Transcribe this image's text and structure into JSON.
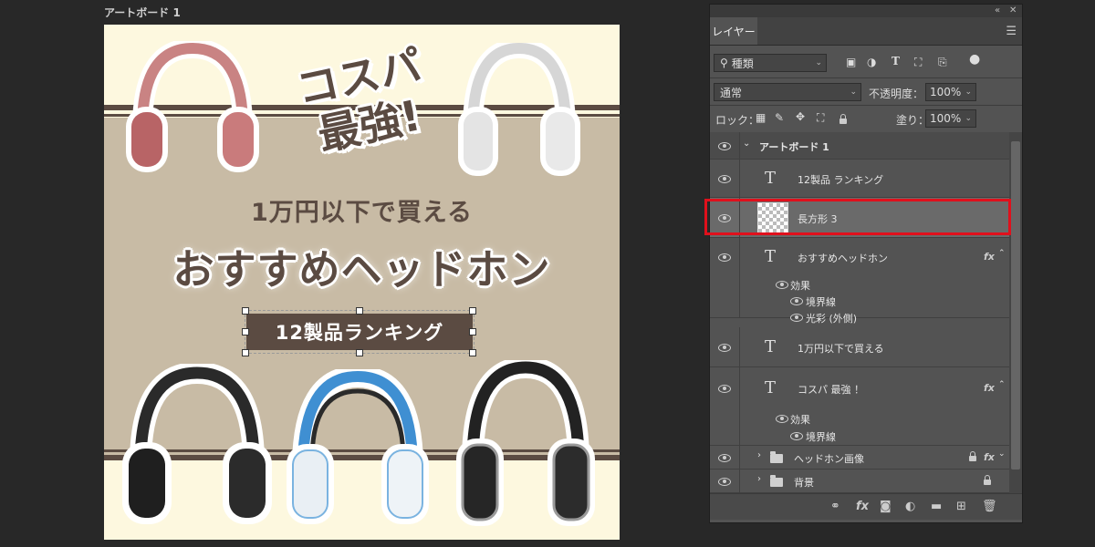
{
  "artboard": {
    "label": "アートボード 1",
    "catch_line1": "コスパ",
    "catch_line2": "最強!",
    "subtitle": "1万円以下で買える",
    "main_title": "おすすめヘッドホン",
    "ranking_label": "12製品ランキング",
    "colors": {
      "background": "#fdf8df",
      "band": "#c8bba5",
      "accent": "#5b4b42"
    }
  },
  "panel": {
    "collapse_icon": "«",
    "close_icon": "✕",
    "tab_label": "レイヤー",
    "menu_icon": "hamburger-menu-icon",
    "filter": {
      "search_icon": "⚲",
      "value": "種類"
    },
    "filter_icons": [
      "pixel-filter-icon",
      "adjustment-filter-icon",
      "type-filter-icon",
      "shape-filter-icon",
      "smartobject-filter-icon",
      "filter-toggle-icon"
    ],
    "blend_mode": "通常",
    "opacity_label": "不透明度：",
    "opacity_value": "100%",
    "lock_label": "ロック：",
    "fill_label": "塗り：",
    "fill_value": "100%",
    "layers": [
      {
        "name": "アートボード 1",
        "kind": "artboard"
      },
      {
        "name": "12製品 ランキング",
        "kind": "text"
      },
      {
        "name": "長方形 3",
        "kind": "shape",
        "selected": true
      },
      {
        "name": "おすすめヘッドホン",
        "kind": "text",
        "fx": "fx",
        "effects_label": "効果",
        "effects": [
          "境界線",
          "光彩 (外側)"
        ]
      },
      {
        "name": "1万円以下で買える",
        "kind": "text"
      },
      {
        "name": "コスパ  最強 ！",
        "kind": "text",
        "fx": "fx",
        "effects_label": "効果",
        "effects": [
          "境界線"
        ]
      },
      {
        "name": "ヘッドホン画像",
        "kind": "group",
        "fx": "fx",
        "locked": true
      },
      {
        "name": "背景",
        "kind": "group",
        "locked": true
      }
    ],
    "text_glyph": "T",
    "bottom_icons": [
      "link-layers-icon",
      "add-style-icon",
      "add-mask-icon",
      "new-adjustment-icon",
      "new-group-icon",
      "new-layer-icon",
      "delete-layer-icon"
    ]
  }
}
